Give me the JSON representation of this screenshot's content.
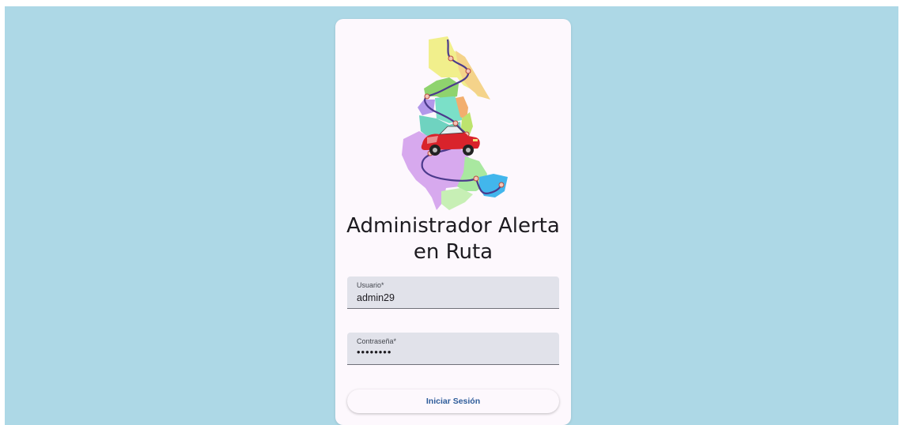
{
  "app": {
    "title": "Administrador Alerta en Ruta",
    "title_line1": "Administrador Alerta",
    "title_line2": "en Ruta"
  },
  "logo": {
    "icon": "map-route-car-logo"
  },
  "form": {
    "username": {
      "label": "Usuario*",
      "value": "admin29"
    },
    "password": {
      "label": "Contraseña*",
      "value": "••••••••"
    },
    "submit_label": "Iniciar Sesión"
  },
  "colors": {
    "background": "#add8e6",
    "card": "#fdf8fd",
    "field": "#e1e2ea",
    "button_text": "#2e5c9a"
  }
}
